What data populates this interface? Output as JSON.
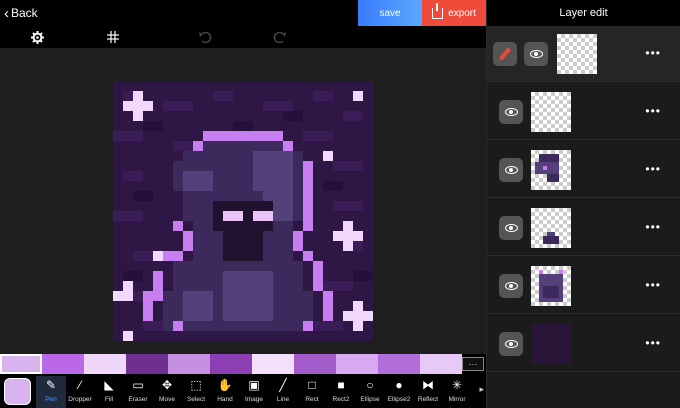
{
  "topbar": {
    "back_label": "Back",
    "save_label": "save",
    "export_label": "export"
  },
  "toolbar2": {
    "icons": [
      "gear-icon",
      "grid-icon",
      "undo-icon",
      "redo-icon"
    ]
  },
  "palette": {
    "colors": [
      "#d9b3ee",
      "#b968e8",
      "#efd7fa",
      "#6e2f8e",
      "#c58fe2",
      "#8b3fb3",
      "#f2e0fb",
      "#a25bc8",
      "#d8a8f0",
      "#b36fd9",
      "#e7c9f7"
    ],
    "selected": 0,
    "more_label": "···"
  },
  "tools": {
    "current_color": "#d9b3ee",
    "items": [
      {
        "label": "Pen",
        "icon": "pen-icon"
      },
      {
        "label": "Dropper",
        "icon": "dropper-icon"
      },
      {
        "label": "Fill",
        "icon": "fill-icon"
      },
      {
        "label": "Eraser",
        "icon": "eraser-icon"
      },
      {
        "label": "Move",
        "icon": "move-icon"
      },
      {
        "label": "Select",
        "icon": "select-icon"
      },
      {
        "label": "Hand",
        "icon": "hand-icon"
      },
      {
        "label": "Image",
        "icon": "image-icon"
      },
      {
        "label": "Line",
        "icon": "line-icon"
      },
      {
        "label": "Rect",
        "icon": "rect-icon"
      },
      {
        "label": "Rect2",
        "icon": "rect-filled-icon"
      },
      {
        "label": "Ellipse",
        "icon": "ellipse-icon"
      },
      {
        "label": "Ellipse2",
        "icon": "ellipse-filled-icon"
      },
      {
        "label": "Reflect",
        "icon": "reflect-icon"
      },
      {
        "label": "Mirror",
        "icon": "mirror-icon"
      }
    ],
    "active": 0,
    "more_label": "▸"
  },
  "layers_panel": {
    "title": "Layer edit",
    "more_label": "•••"
  }
}
